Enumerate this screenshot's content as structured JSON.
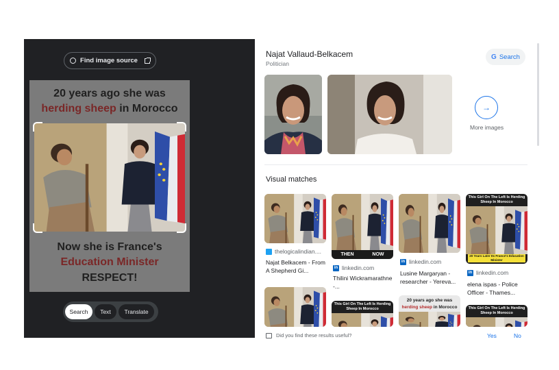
{
  "lens": {
    "find_source_label": "Find image source",
    "meme": {
      "top_line1": "20 years ago she was",
      "top_line2_red": "herding sheep",
      "top_line2_rest": " in Morocco",
      "bottom_line1": "Now she is France's",
      "bottom_line2_red": "Education Minister",
      "bottom_line3": "RESPECT!"
    },
    "tabs": [
      "Search",
      "Text",
      "Translate"
    ],
    "active_tab": "Search"
  },
  "knowledge": {
    "name": "Najat Vallaud-Belkacem",
    "subtitle": "Politician",
    "search_label": "Search",
    "more_images_label": "More images"
  },
  "visual_matches": {
    "title": "Visual matches",
    "cards": [
      {
        "source": "thelogicalindian....",
        "caption": "Najat Belkacem - From A Shepherd Gi..."
      },
      {
        "source": "linkedin.com",
        "caption": "Thilini Wickramarathne -...",
        "overlay_left": "THEN",
        "overlay_right": "NOW"
      },
      {
        "source": "linkedin.com",
        "caption": "Lusine Margaryan - researcher - Yereva..."
      },
      {
        "source": "linkedin.com",
        "caption": "elena ispas - Police Officer - Thames...",
        "banner_top": "This Girl On The Left Is Herding Sheep In Morocco",
        "banner_bottom": "20 Years Later Its France's Education Minister"
      }
    ],
    "row2": {
      "card2_banner": "This Girl On The Left Is Herding Sheep In Morocco",
      "card3_line1": "20 years ago she was",
      "card3_line2_red": "herding sheep",
      "card3_line2_rest": " in Morocco",
      "card4_banner": "This Girl On The Left Is Herding Sheep In Morocco"
    }
  },
  "feedback": {
    "question": "Did you find these results useful?",
    "yes": "Yes",
    "no": "No"
  }
}
